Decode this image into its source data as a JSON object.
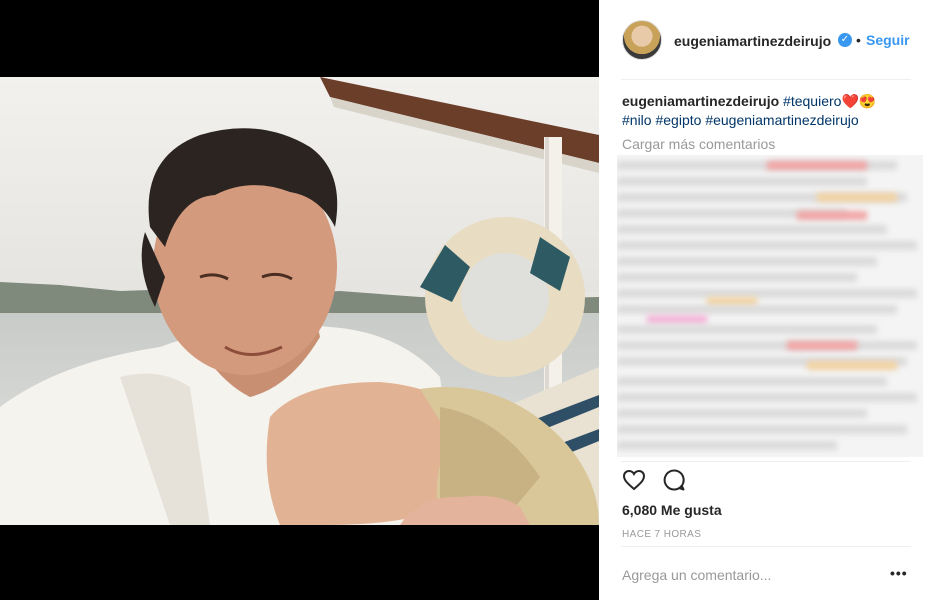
{
  "post": {
    "username": "eugeniamartinezdeirujo",
    "dot": "•",
    "follow_label": "Seguir",
    "caption": {
      "username": "eugeniamartinezdeirujo",
      "tag1": "#tequiero",
      "emoji": "❤️😍",
      "tag2": "#nilo",
      "tag3": "#egipto",
      "tag4": "#eugeniamartinezdeirujo"
    },
    "load_more": "Cargar más comentarios",
    "likes": "6,080 Me gusta",
    "time": "HACE 7 HORAS",
    "comment_placeholder": "Agrega un comentario...",
    "more_icon": "•••"
  },
  "icons": {
    "like": "heart-outline-icon",
    "comment": "speech-bubble-icon",
    "verified": "verified-badge-icon"
  },
  "colors": {
    "link": "#3897f0",
    "hashtag": "#003569",
    "text": "#262626",
    "muted": "#999999"
  }
}
